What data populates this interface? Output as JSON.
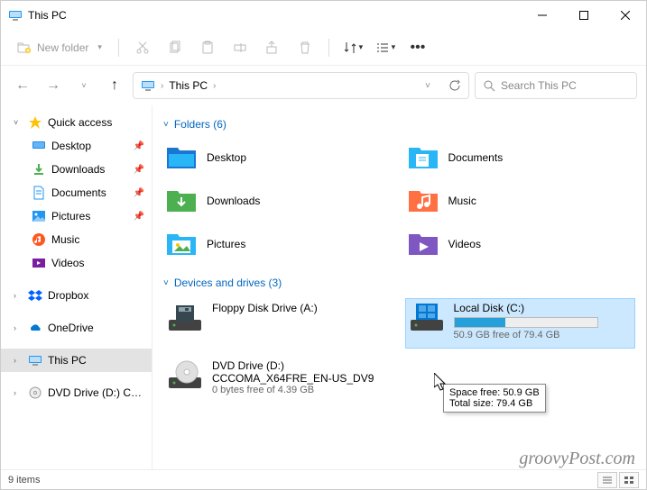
{
  "window": {
    "title": "This PC"
  },
  "toolbar": {
    "new_folder": "New folder"
  },
  "address": {
    "location": "This PC"
  },
  "search": {
    "placeholder": "Search This PC"
  },
  "sidebar": {
    "quick_access": "Quick access",
    "items": [
      {
        "label": "Desktop"
      },
      {
        "label": "Downloads"
      },
      {
        "label": "Documents"
      },
      {
        "label": "Pictures"
      },
      {
        "label": "Music"
      },
      {
        "label": "Videos"
      }
    ],
    "dropbox": "Dropbox",
    "onedrive": "OneDrive",
    "this_pc": "This PC",
    "dvd": "DVD Drive (D:) C…"
  },
  "groups": {
    "folders": {
      "label": "Folders (6)"
    },
    "drives": {
      "label": "Devices and drives (3)"
    }
  },
  "folders": [
    {
      "label": "Desktop"
    },
    {
      "label": "Documents"
    },
    {
      "label": "Downloads"
    },
    {
      "label": "Music"
    },
    {
      "label": "Pictures"
    },
    {
      "label": "Videos"
    }
  ],
  "drives": {
    "floppy": {
      "label": "Floppy Disk Drive (A:)"
    },
    "local": {
      "label": "Local Disk (C:)",
      "sub": "50.9 GB free of 79.4 GB"
    },
    "dvd": {
      "label": "DVD Drive (D:)",
      "sub1": "CCCOMA_X64FRE_EN-US_DV9",
      "sub2": "0 bytes free of 4.39 GB"
    }
  },
  "tooltip": {
    "line1": "Space free: 50.9 GB",
    "line2": "Total size: 79.4 GB"
  },
  "status": {
    "items": "9 items"
  },
  "watermark": "groovyPost.com"
}
